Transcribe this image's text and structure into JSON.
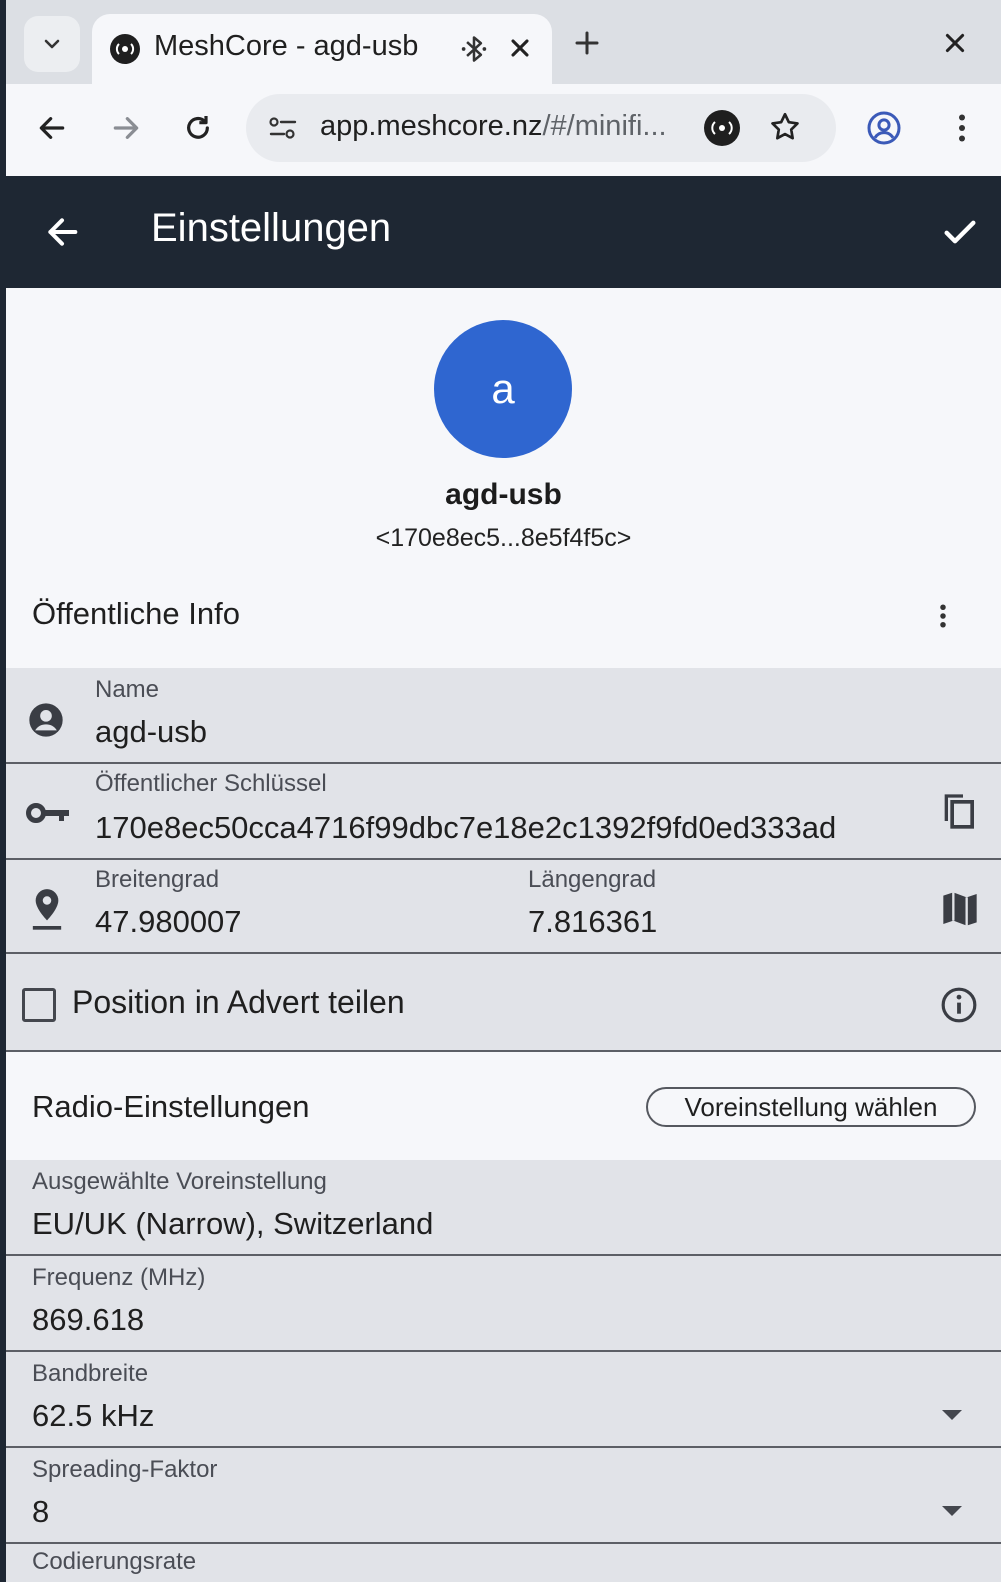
{
  "browser": {
    "tab_title": "MeshCore - agd-usb",
    "url_host": "app.meshcore.nz",
    "url_rest": "/#/minifi..."
  },
  "appbar": {
    "title": "Einstellungen"
  },
  "profile": {
    "avatar_letter": "a",
    "name": "agd-usb",
    "key_short": "<170e8ec5...8e5f4f5c>"
  },
  "public_info": {
    "section_title": "Öffentliche Info",
    "name_label": "Name",
    "name_value": "agd-usb",
    "pubkey_label": "Öffentlicher Schlüssel",
    "pubkey_value": "170e8ec50cca4716f99dbc7e18e2c1392f9fd0ed333ad",
    "lat_label": "Breitengrad",
    "lat_value": "47.980007",
    "lon_label": "Längengrad",
    "lon_value": "7.816361",
    "share_position_label": "Position in Advert teilen",
    "share_position_checked": false
  },
  "radio": {
    "section_title": "Radio-Einstellungen",
    "preset_button": "Voreinstellung wählen",
    "selected_preset_label": "Ausgewählte Voreinstellung",
    "selected_preset_value": "EU/UK (Narrow), Switzerland",
    "frequency_label": "Frequenz (MHz)",
    "frequency_value": "869.618",
    "bandwidth_label": "Bandbreite",
    "bandwidth_value": "62.5 kHz",
    "spreading_label": "Spreading-Faktor",
    "spreading_value": "8",
    "coding_label": "Codierungsrate"
  },
  "colors": {
    "appbar": "#1e2733",
    "avatar": "#2f66d0",
    "field_bg": "#e1e3e8",
    "page_bg": "#f6f7fa"
  }
}
